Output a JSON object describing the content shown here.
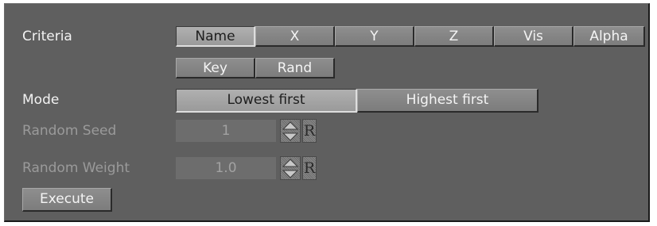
{
  "criteria": {
    "label": "Criteria",
    "buttons": [
      "Name",
      "X",
      "Y",
      "Z",
      "Vis",
      "Alpha",
      "Key",
      "Rand"
    ],
    "selected": "Name"
  },
  "mode": {
    "label": "Mode",
    "options": [
      "Lowest first",
      "Highest first"
    ],
    "selected": "Lowest first"
  },
  "random_seed": {
    "label": "Random Seed",
    "value": "1",
    "reset_label": "R"
  },
  "random_weight": {
    "label": "Random Weight",
    "value": "1.0",
    "reset_label": "R"
  },
  "execute": {
    "label": "Execute"
  },
  "colors": {
    "panel_background": "#5f5f5f",
    "button_face": "#848484",
    "active_button_face": "#a4a4a4",
    "text": "#f2f2f2",
    "disabled_text": "#9a9a9a"
  }
}
